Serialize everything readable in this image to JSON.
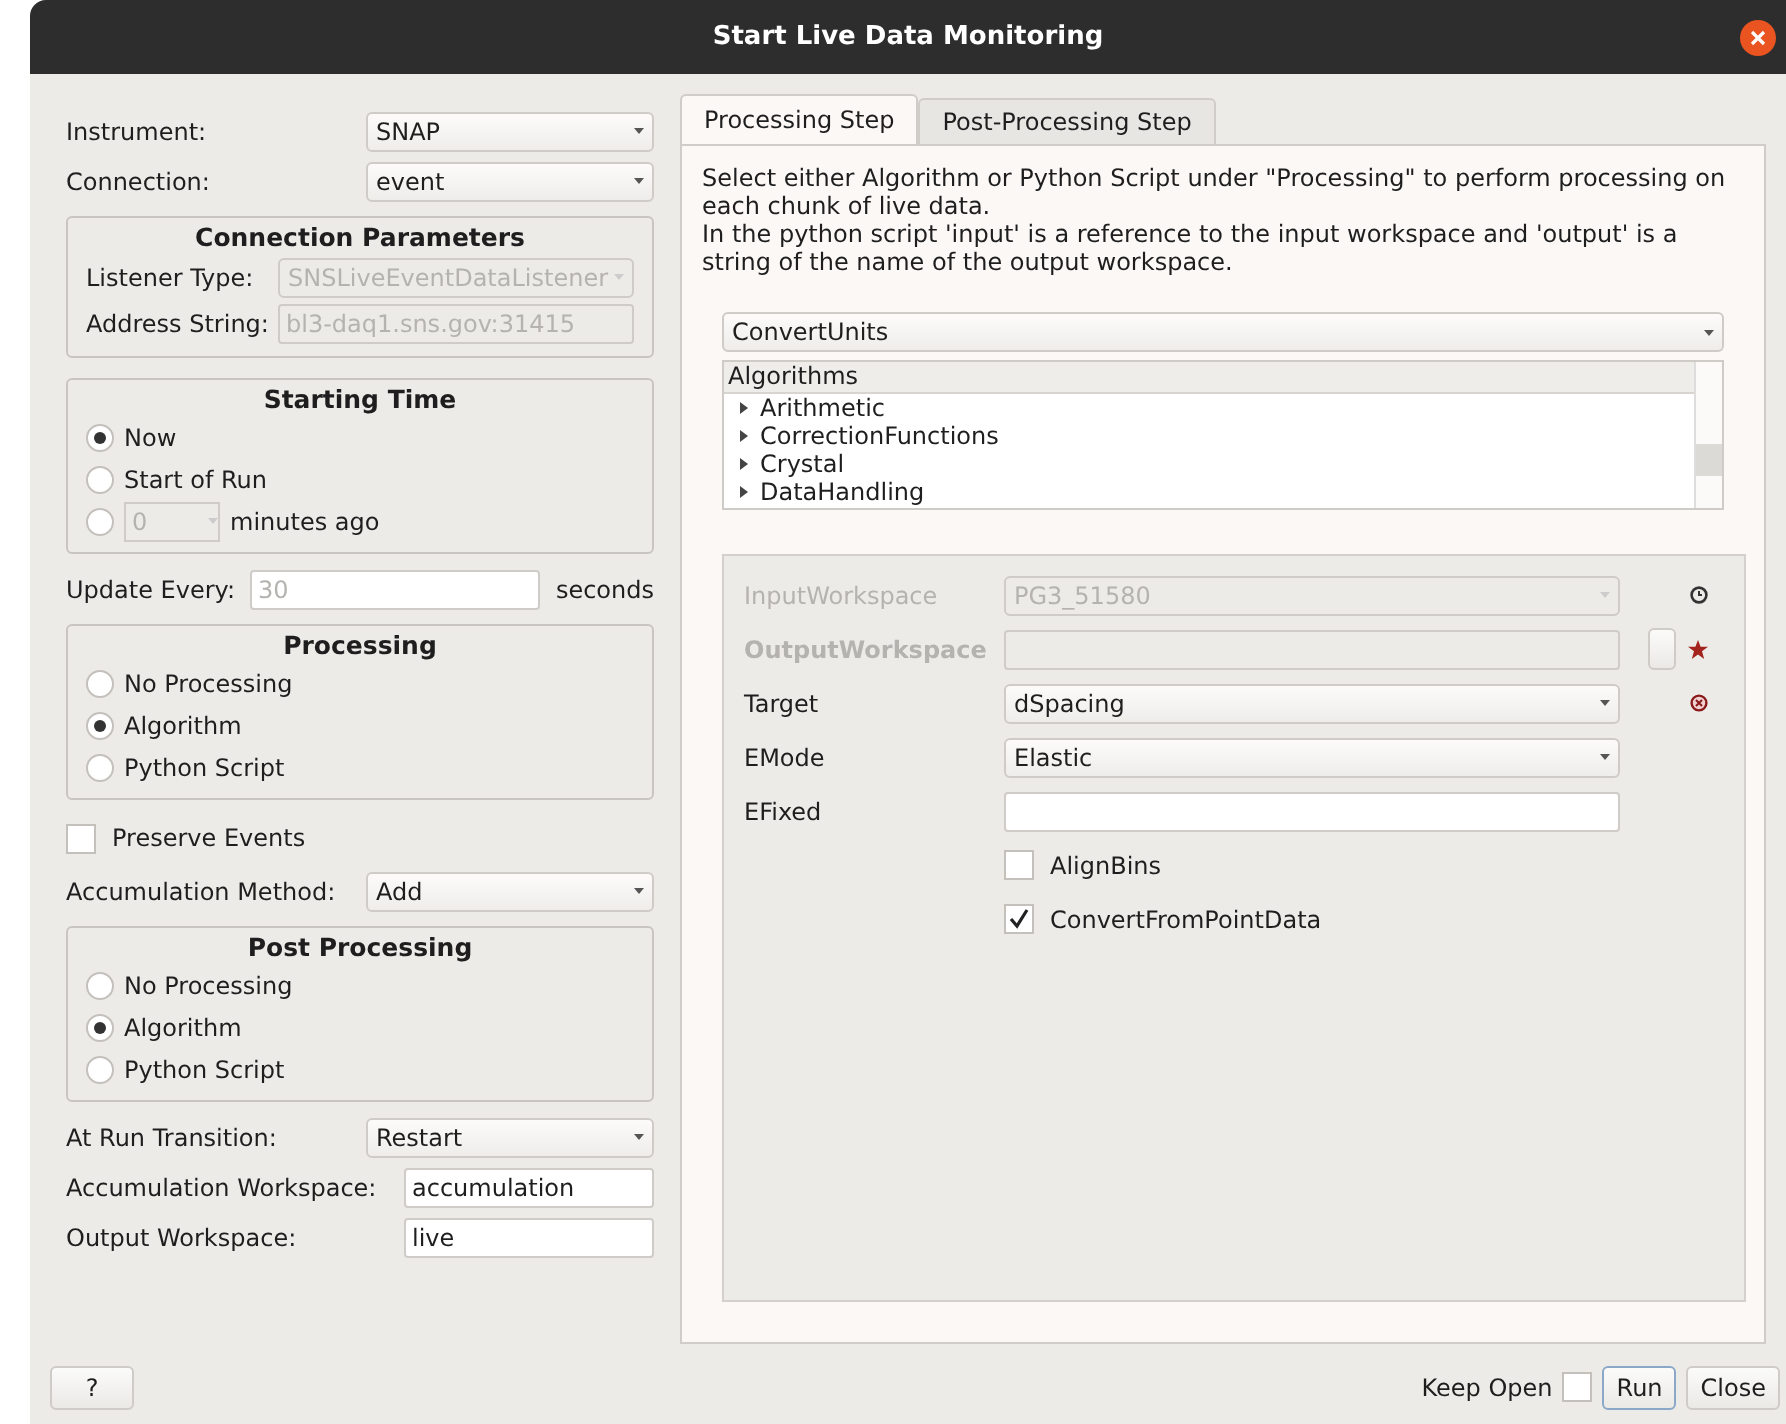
{
  "window": {
    "title": "Start Live Data Monitoring"
  },
  "left": {
    "instrument": {
      "label": "Instrument:",
      "value": "SNAP"
    },
    "connection": {
      "label": "Connection:",
      "value": "event"
    },
    "connection_parameters": {
      "title": "Connection Parameters",
      "listener_type": {
        "label": "Listener Type:",
        "value": "SNSLiveEventDataListener",
        "disabled": true
      },
      "address_string": {
        "label": "Address String:",
        "value": "bl3-daq1.sns.gov:31415",
        "disabled": true
      }
    },
    "starting_time": {
      "title": "Starting Time",
      "options": [
        {
          "label": "Now",
          "selected": true
        },
        {
          "label": "Start of Run",
          "selected": false
        },
        {
          "label": "minutes ago",
          "selected": false,
          "spin_value": "0"
        }
      ]
    },
    "update_every": {
      "label": "Update Every:",
      "placeholder": "30",
      "unit": "seconds"
    },
    "processing": {
      "title": "Processing",
      "options": [
        {
          "label": "No Processing",
          "selected": false
        },
        {
          "label": "Algorithm",
          "selected": true
        },
        {
          "label": "Python Script",
          "selected": false
        }
      ]
    },
    "preserve_events": {
      "label": "Preserve Events",
      "checked": false
    },
    "accumulation_method": {
      "label": "Accumulation Method:",
      "value": "Add"
    },
    "post_processing": {
      "title": "Post Processing",
      "options": [
        {
          "label": "No Processing",
          "selected": false
        },
        {
          "label": "Algorithm",
          "selected": true
        },
        {
          "label": "Python Script",
          "selected": false
        }
      ]
    },
    "at_run_transition": {
      "label": "At Run Transition:",
      "value": "Restart"
    },
    "accumulation_workspace": {
      "label": "Accumulation Workspace:",
      "value": "accumulation"
    },
    "output_workspace": {
      "label": "Output Workspace:",
      "value": "live"
    }
  },
  "tabs": [
    {
      "label": "Processing Step",
      "selected": true
    },
    {
      "label": "Post-Processing Step",
      "selected": false
    }
  ],
  "description": [
    "Select either Algorithm or Python Script under \"Processing\" to perform processing on each chunk of live data.",
    "In the python script 'input' is a reference to the input workspace and 'output' is a string of the name of the output workspace."
  ],
  "algorithm_combo": {
    "value": "ConvertUnits"
  },
  "algorithm_tree": {
    "header": "Algorithms",
    "items": [
      {
        "label": "Arithmetic",
        "expanded": false
      },
      {
        "label": "CorrectionFunctions",
        "expanded": false
      },
      {
        "label": "Crystal",
        "expanded": false
      },
      {
        "label": "DataHandling",
        "expanded": false
      }
    ]
  },
  "properties": [
    {
      "kind": "combo",
      "name": "InputWorkspace",
      "value": "PG3_51580",
      "disabled": true,
      "history": true,
      "required": false,
      "invalid": false
    },
    {
      "kind": "browse",
      "name": "OutputWorkspace",
      "disabled": true,
      "history": false,
      "required": true,
      "invalid": false
    },
    {
      "kind": "combo",
      "name": "Target",
      "value": "dSpacing",
      "disabled": false,
      "history": false,
      "required": false,
      "invalid": true
    },
    {
      "kind": "combo",
      "name": "EMode",
      "value": "Elastic",
      "disabled": false,
      "history": false,
      "required": false,
      "invalid": false
    },
    {
      "kind": "text",
      "name": "EFixed",
      "disabled": false,
      "history": false,
      "required": false,
      "invalid": false
    },
    {
      "kind": "checkbox",
      "name": "AlignBins",
      "checked": false
    },
    {
      "kind": "checkbox",
      "name": "ConvertFromPointData",
      "checked": true
    }
  ],
  "footer": {
    "help": "?",
    "keep_open": {
      "label": "Keep Open",
      "checked": false
    },
    "buttons": [
      {
        "label": "Run",
        "default": true
      },
      {
        "label": "Close",
        "default": false
      }
    ]
  }
}
